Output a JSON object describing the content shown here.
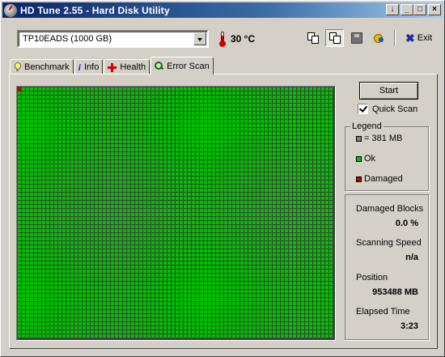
{
  "window": {
    "title": "HD Tune 2.55 - Hard Disk Utility"
  },
  "title_buttons": [
    "↓",
    "_",
    "□",
    "×"
  ],
  "toolbar": {
    "drive": "TP10EADS (1000 GB)",
    "temperature": "30 °C",
    "exit_label": "Exit"
  },
  "tabs": [
    {
      "label": "Benchmark",
      "icon": "bulb-icon"
    },
    {
      "label": "Info",
      "icon": "info-icon"
    },
    {
      "label": "Health",
      "icon": "health-cross-icon"
    },
    {
      "label": "Error Scan",
      "icon": "magnifier-icon",
      "active": true
    }
  ],
  "controls": {
    "start_label": "Start",
    "quick_scan_label": "Quick Scan",
    "quick_scan_checked": true
  },
  "legend": {
    "title": "Legend",
    "items": [
      {
        "label": "= 381 MB",
        "color": "#808080"
      },
      {
        "label": "Ok",
        "color": "#00c000"
      },
      {
        "label": "Damaged",
        "color": "#c00000"
      }
    ]
  },
  "stats": {
    "damaged_blocks_label": "Damaged Blocks",
    "damaged_blocks_value": "0.0 %",
    "scanning_speed_label": "Scanning Speed",
    "scanning_speed_value": "n/a",
    "position_label": "Position",
    "position_value": "953488 MB",
    "elapsed_time_label": "Elapsed Time",
    "elapsed_time_value": "3:23"
  },
  "scan_grid": {
    "ok_color": "#00c000",
    "damaged_color": "#c00000",
    "damaged_cells": [
      0
    ]
  }
}
